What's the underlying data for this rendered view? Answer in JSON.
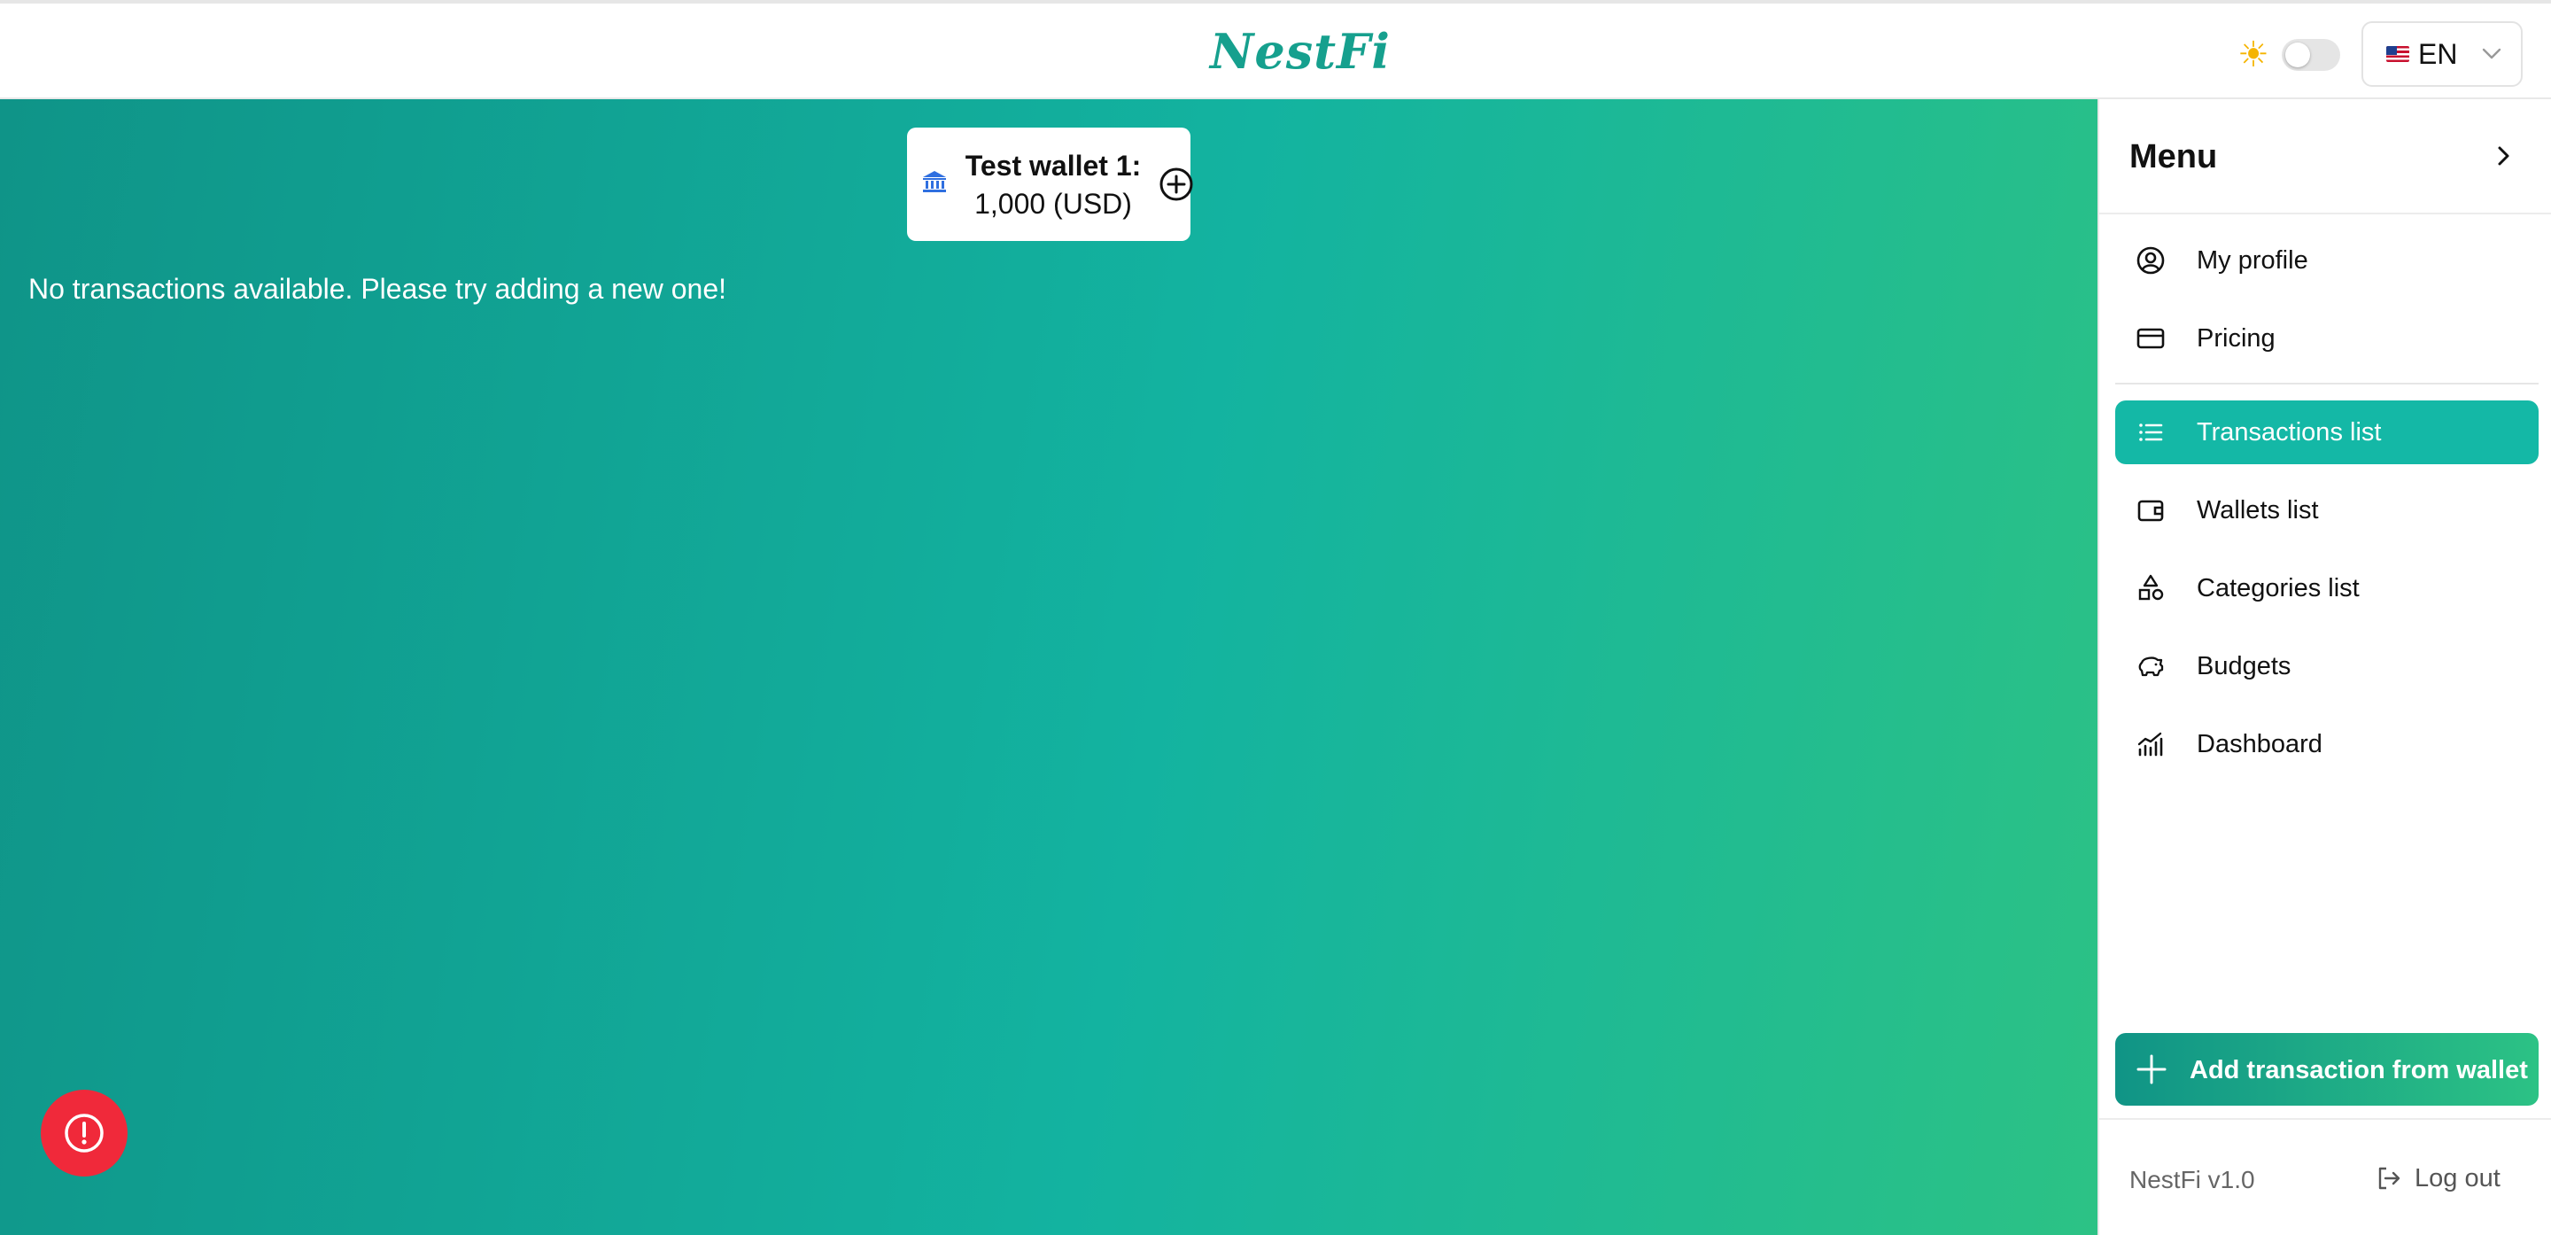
{
  "header": {
    "logo_text": "NestFi",
    "theme_icon": "sun-icon",
    "language": {
      "code": "EN",
      "flag": "us-flag-icon"
    }
  },
  "main": {
    "wallet_card": {
      "name": "Test wallet 1:",
      "balance": "1,000 (USD)",
      "icon": "bank-icon",
      "action_icon": "plus-circle-icon"
    },
    "empty_message": "No transactions available. Please try adding a new one!",
    "help_icon": "alert-circle-icon"
  },
  "sidebar": {
    "title": "Menu",
    "items": [
      {
        "label": "My profile",
        "icon": "user-circle-icon"
      },
      {
        "label": "Pricing",
        "icon": "credit-card-icon"
      },
      {
        "label": "Transactions list",
        "icon": "list-icon",
        "active": true
      },
      {
        "label": "Wallets list",
        "icon": "wallet-icon"
      },
      {
        "label": "Categories list",
        "icon": "shapes-icon"
      },
      {
        "label": "Budgets",
        "icon": "piggy-bank-icon"
      },
      {
        "label": "Dashboard",
        "icon": "chart-icon"
      }
    ],
    "add_transaction_label": "Add transaction from wallet",
    "version": "NestFi v1.0",
    "logout_label": "Log out"
  },
  "colors": {
    "accent": "#14b8a6",
    "gradient_start": "#0f9488",
    "gradient_end": "#2cc285",
    "alert": "#f0293a",
    "logo": "#16a08e"
  }
}
